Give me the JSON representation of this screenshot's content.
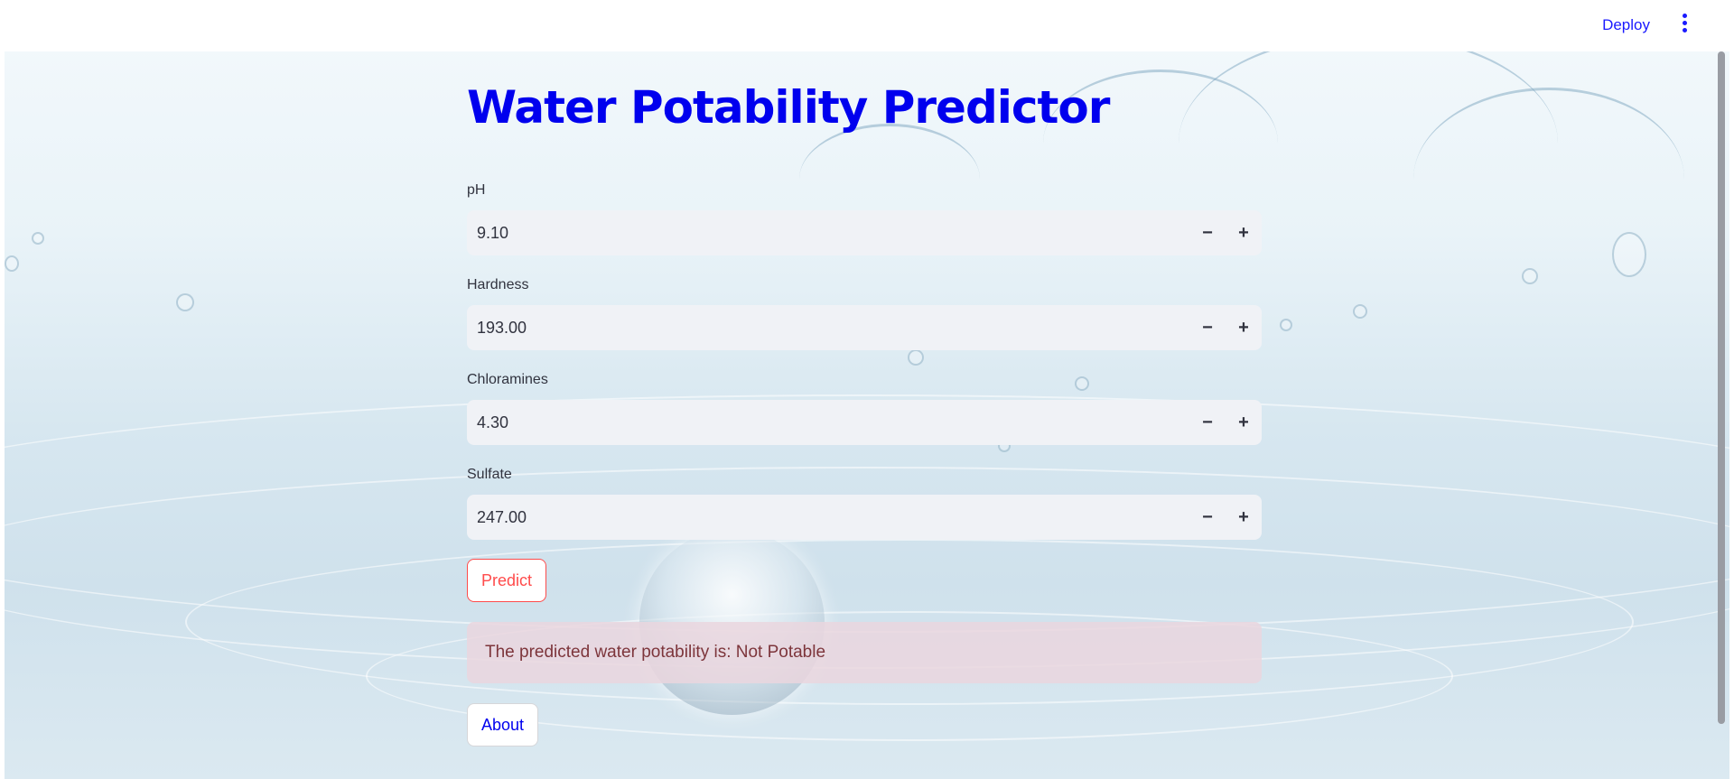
{
  "header": {
    "deploy_label": "Deploy",
    "menu_icon": "vertical-ellipsis-icon"
  },
  "main": {
    "title": "Water Potability Predictor",
    "fields": [
      {
        "label": "pH",
        "value": "9.10"
      },
      {
        "label": "Hardness",
        "value": "193.00"
      },
      {
        "label": "Chloramines",
        "value": "4.30"
      },
      {
        "label": "Sulfate",
        "value": "247.00"
      }
    ],
    "stepper": {
      "minus": "−",
      "plus": "+"
    },
    "predict_label": "Predict",
    "result_text": "The predicted water potability is: Not Potable",
    "about_label": "About"
  },
  "colors": {
    "title": "#0000ee",
    "accent_red": "#ff4b4b",
    "link_blue": "#1a1aff",
    "input_bg": "#f0f2f6",
    "error_text": "#7d353b"
  }
}
